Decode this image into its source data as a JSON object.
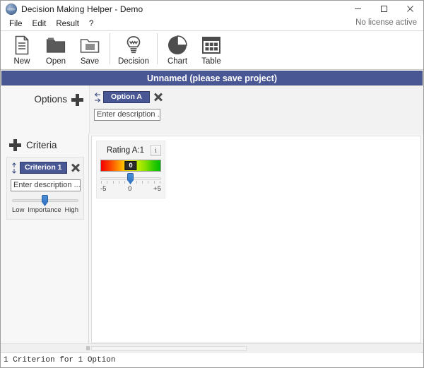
{
  "window": {
    "title": "Decision Making Helper - Demo",
    "app_icon": "globe-icon",
    "minimize": "minimize-icon",
    "maximize": "maximize-icon",
    "close": "close-icon"
  },
  "menu": {
    "items": [
      {
        "label": "File"
      },
      {
        "label": "Edit"
      },
      {
        "label": "Result"
      },
      {
        "label": "?"
      }
    ],
    "license_status": "No license active"
  },
  "toolbar": {
    "buttons": [
      {
        "label": "New",
        "icon": "document-icon"
      },
      {
        "label": "Open",
        "icon": "folder-open-icon"
      },
      {
        "label": "Save",
        "icon": "folder-save-icon"
      },
      {
        "label": "Decision",
        "icon": "lightbulb-icon"
      },
      {
        "label": "Chart",
        "icon": "pie-chart-icon"
      },
      {
        "label": "Table",
        "icon": "table-grid-icon"
      }
    ]
  },
  "project": {
    "banner_title": "Unnamed (please save project)",
    "banner_color": "#4a5795"
  },
  "options": {
    "header_label": "Options",
    "add_label": "+",
    "items": [
      {
        "name": "Option A",
        "description_placeholder": "Enter description ...",
        "move_left": "arrow-left-icon",
        "move_right": "arrow-right-icon",
        "remove": "close-icon"
      }
    ]
  },
  "criteria": {
    "header_label": "Criteria",
    "add_label": "+",
    "items": [
      {
        "name": "Criterion 1",
        "description_placeholder": "Enter description ...",
        "move_up": "arrow-up-icon",
        "move_down": "arrow-down-icon",
        "remove": "close-icon",
        "importance": {
          "low_label": "Low",
          "center_label": "Importance",
          "high_label": "High",
          "value_percent": 50
        }
      }
    ]
  },
  "ratings": {
    "cards": [
      {
        "title": "Rating A:1",
        "info_label": "i",
        "value": "0",
        "min_label": "-5",
        "mid_label": "0",
        "max_label": "+5",
        "value_percent": 50,
        "gradient_start": "#f50000",
        "gradient_mid": "#f2f200",
        "gradient_end": "#00bb00"
      }
    ]
  },
  "status": {
    "text": "1 Criterion for 1 Option"
  }
}
